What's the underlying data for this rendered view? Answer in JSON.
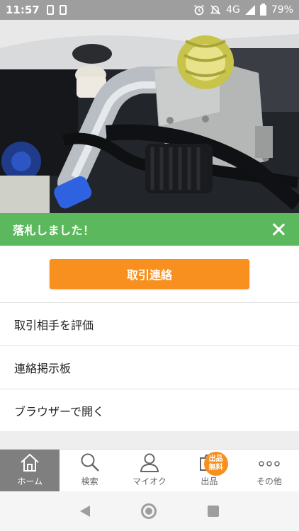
{
  "status_bar": {
    "time": "11:57",
    "network": "4G",
    "battery": "79%",
    "icons": [
      "sim-card-icon",
      "battery-saver-icon",
      "alarm-icon",
      "notifications-off-icon",
      "signal-icon",
      "battery-icon"
    ]
  },
  "photo": {
    "subject": "engine-bay-photo"
  },
  "notice": {
    "text": "落札しました！",
    "color": "#5cb85c"
  },
  "primary_action": {
    "label": "取引連絡",
    "color": "#f7901e"
  },
  "menu": [
    {
      "label": "取引相手を評価"
    },
    {
      "label": "連絡掲示板"
    },
    {
      "label": "ブラウザーで開く"
    }
  ],
  "bottom_nav": {
    "items": [
      {
        "label": "ホーム",
        "icon": "home-icon",
        "active": true
      },
      {
        "label": "検索",
        "icon": "search-icon",
        "active": false
      },
      {
        "label": "マイオク",
        "icon": "person-icon",
        "active": false
      },
      {
        "label": "出品",
        "icon": "camera-icon",
        "active": false,
        "badge": [
          "出品",
          "無料"
        ]
      },
      {
        "label": "その他",
        "icon": "more-icon",
        "active": false
      }
    ]
  },
  "system_nav": [
    "back-icon",
    "home-circle-icon",
    "recents-icon"
  ]
}
